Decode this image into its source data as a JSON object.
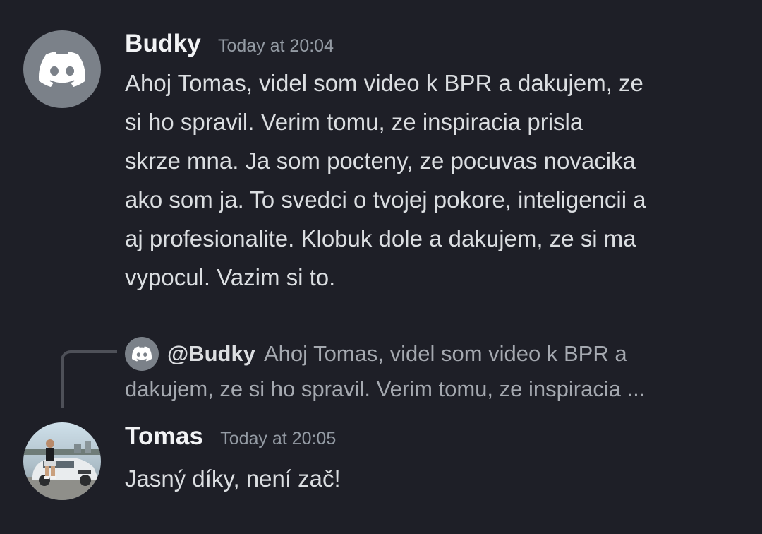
{
  "messages": [
    {
      "username": "Budky",
      "timestamp": "Today at 20:04",
      "avatar_icon": "discord-logo-icon",
      "lines": [
        "Ahoj Tomas, videl som video k BPR a dakujem, ze",
        "si ho spravil. Verim tomu, ze inspiracia prisla",
        "skrze mna. Ja som pocteny, ze pocuvas novacika",
        "ako som ja. To svedci o tvojej pokore, inteligencii a",
        "aj profesionalite. Klobuk dole a dakujem, ze si ma",
        "vypocul. Vazim si to."
      ]
    },
    {
      "reply": {
        "avatar_icon": "discord-logo-icon",
        "mention": "@Budky",
        "line1": "Ahoj Tomas, videl som video k BPR a",
        "line2": "dakujem, ze si ho spravil. Verim tomu, ze inspiracia ..."
      },
      "username": "Tomas",
      "timestamp": "Today at 20:05",
      "avatar_icon": "user-photo-avatar",
      "lines": [
        "Jasný díky, není zač!"
      ]
    }
  ],
  "colors": {
    "background": "#1e1f27",
    "username": "#f2f3f5",
    "timestamp": "#949ba4",
    "text": "#dbdee1",
    "discord_avatar_bg": "#7b8189"
  }
}
